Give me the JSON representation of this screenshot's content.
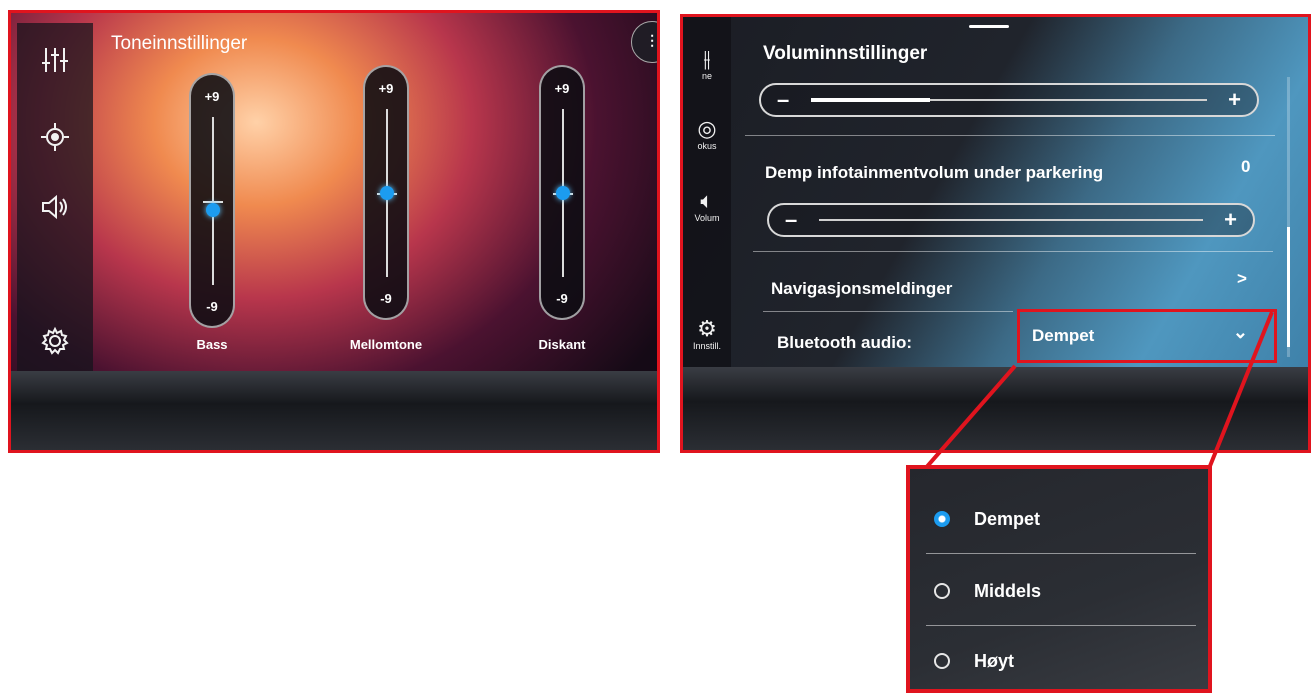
{
  "left_screen": {
    "title": "Toneinnstillinger",
    "sidebar_icons": [
      "equalizer-icon",
      "focus-icon",
      "speaker-icon",
      "settings-icon"
    ],
    "sliders": [
      {
        "name": "Bass",
        "max_label": "+9",
        "min_label": "-9",
        "value": -1
      },
      {
        "name": "Mellomtone",
        "max_label": "+9",
        "min_label": "-9",
        "value": 0
      },
      {
        "name": "Diskant",
        "max_label": "+9",
        "min_label": "-9",
        "value": 0
      }
    ]
  },
  "right_screen": {
    "sidebar": [
      {
        "icon": "equalizer-icon",
        "label": "ne"
      },
      {
        "icon": "focus-icon",
        "label": "okus"
      },
      {
        "icon": "speaker-icon",
        "label": "Volum"
      },
      {
        "icon": "settings-icon",
        "label": "Innstill."
      }
    ],
    "title": "Voluminnstillinger",
    "volume": {
      "minus": "–",
      "plus": "+",
      "level": 0.3
    },
    "parking": {
      "label": "Demp infotainmentvolum under parkering",
      "value": "0",
      "minus": "–",
      "plus": "+",
      "level": 0.0
    },
    "navigation_messages": {
      "label": "Navigasjonsmeldinger",
      "chevron": ">"
    },
    "bluetooth": {
      "label": "Bluetooth audio:",
      "value": "Dempet",
      "chevron": "⌄"
    }
  },
  "popup": {
    "options": [
      {
        "label": "Dempet",
        "selected": true
      },
      {
        "label": "Middels",
        "selected": false
      },
      {
        "label": "Høyt",
        "selected": false
      }
    ]
  },
  "colors": {
    "highlight_red": "#e0141e",
    "accent_blue": "#1c9cf0"
  }
}
